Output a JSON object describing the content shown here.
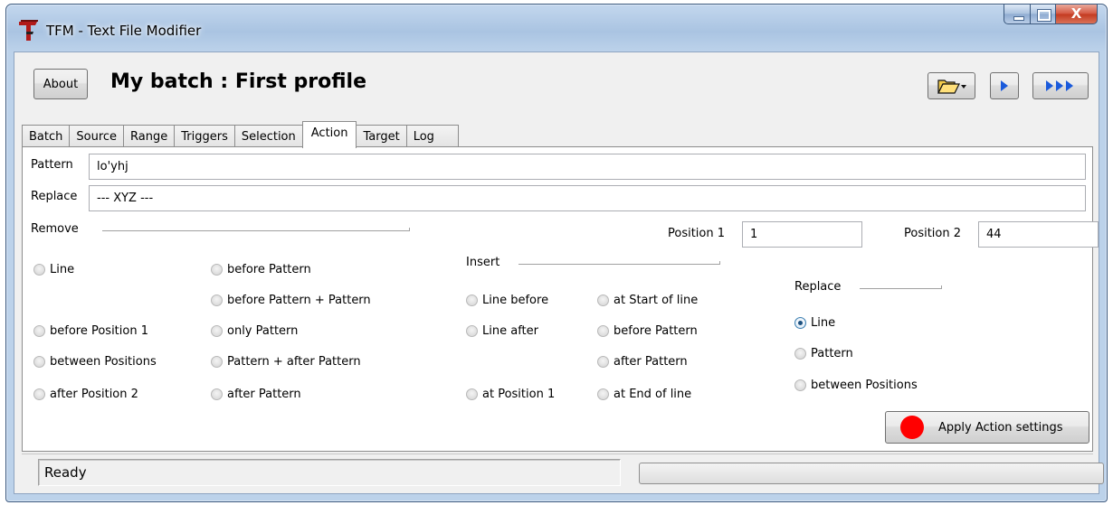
{
  "window": {
    "title": "TFM - Text File Modifier",
    "close_glyph": "X"
  },
  "header": {
    "about_label": "About",
    "batch_title": "My batch : First profile"
  },
  "tabs": [
    {
      "label": "Batch"
    },
    {
      "label": "Source"
    },
    {
      "label": "Range"
    },
    {
      "label": "Triggers"
    },
    {
      "label": "Selection"
    },
    {
      "label": "Action",
      "active": true
    },
    {
      "label": "Target"
    },
    {
      "label": "Log"
    }
  ],
  "action": {
    "pattern_label": "Pattern",
    "pattern_value": "lo'yhj",
    "replace_label": "Replace",
    "replace_value": "--- XYZ ---",
    "remove_label": "Remove",
    "position1_label": "Position 1",
    "position1_value": "1",
    "position2_label": "Position 2",
    "position2_value": "44",
    "remove_options": {
      "line": "Line",
      "before_position1": "before Position 1",
      "between_positions": "between Positions",
      "after_position2": "after Position 2",
      "before_pattern": "before Pattern",
      "before_pattern_plus_pattern": "before Pattern + Pattern",
      "only_pattern": "only Pattern",
      "pattern_plus_after_pattern": "Pattern + after Pattern",
      "after_pattern": "after Pattern"
    },
    "insert_label": "Insert",
    "insert_options": {
      "line_before": "Line before",
      "line_after": "Line after",
      "at_position1": "at Position 1",
      "at_start_of_line": "at Start of line",
      "before_pattern": "before Pattern",
      "after_pattern": "after Pattern",
      "at_end_of_line": "at End of line"
    },
    "replace_group_label": "Replace",
    "replace_options": {
      "line": "Line",
      "pattern": "Pattern",
      "between_positions": "between Positions"
    },
    "replace_selected": "Line",
    "apply_label": "Apply Action settings",
    "apply_indicator_color": "#ff0000"
  },
  "status": {
    "text": "Ready",
    "progress": 0
  },
  "colors": {
    "accent": "#1c5180",
    "run_arrow": "#1a5adb"
  }
}
